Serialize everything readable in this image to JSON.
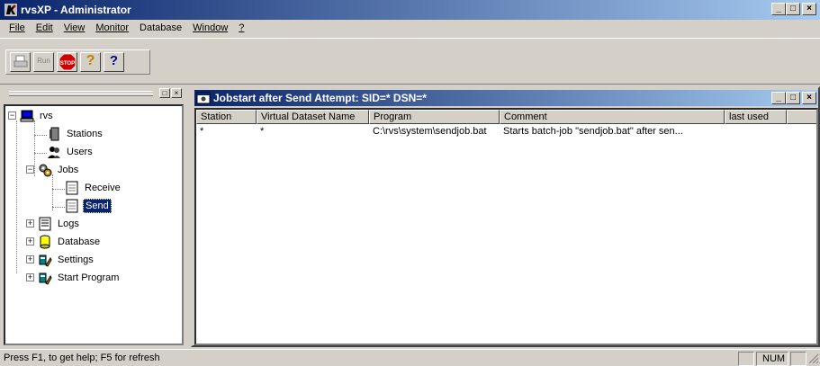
{
  "app": {
    "title": "rvsXP - Administrator",
    "accent": "#0a246a"
  },
  "menu": [
    "File",
    "Edit",
    "View",
    "Monitor",
    "Database",
    "Window",
    "?"
  ],
  "toolbar": {
    "print_label": "print-icon",
    "run_label": "Run",
    "stop_label": "STOP",
    "help_label": "?",
    "context_help_label": "?"
  },
  "tree": {
    "root": "rvs",
    "items": {
      "stations": "Stations",
      "users": "Users",
      "jobs": "Jobs",
      "receive": "Receive",
      "send": "Send",
      "logs": "Logs",
      "database": "Database",
      "settings": "Settings",
      "start_program": "Start Program"
    }
  },
  "child": {
    "title": "Jobstart after Send Attempt: SID=* DSN=*",
    "columns": [
      "Station",
      "Virtual Dataset Name",
      "Program",
      "Comment",
      "last used"
    ],
    "rows": [
      [
        "*",
        "*",
        "C:\\rvs\\system\\sendjob.bat",
        "Starts batch-job \"sendjob.bat\" after sen...",
        ""
      ]
    ]
  },
  "status": {
    "text": "Press F1, to get help; F5 for refresh",
    "num": "NUM"
  }
}
